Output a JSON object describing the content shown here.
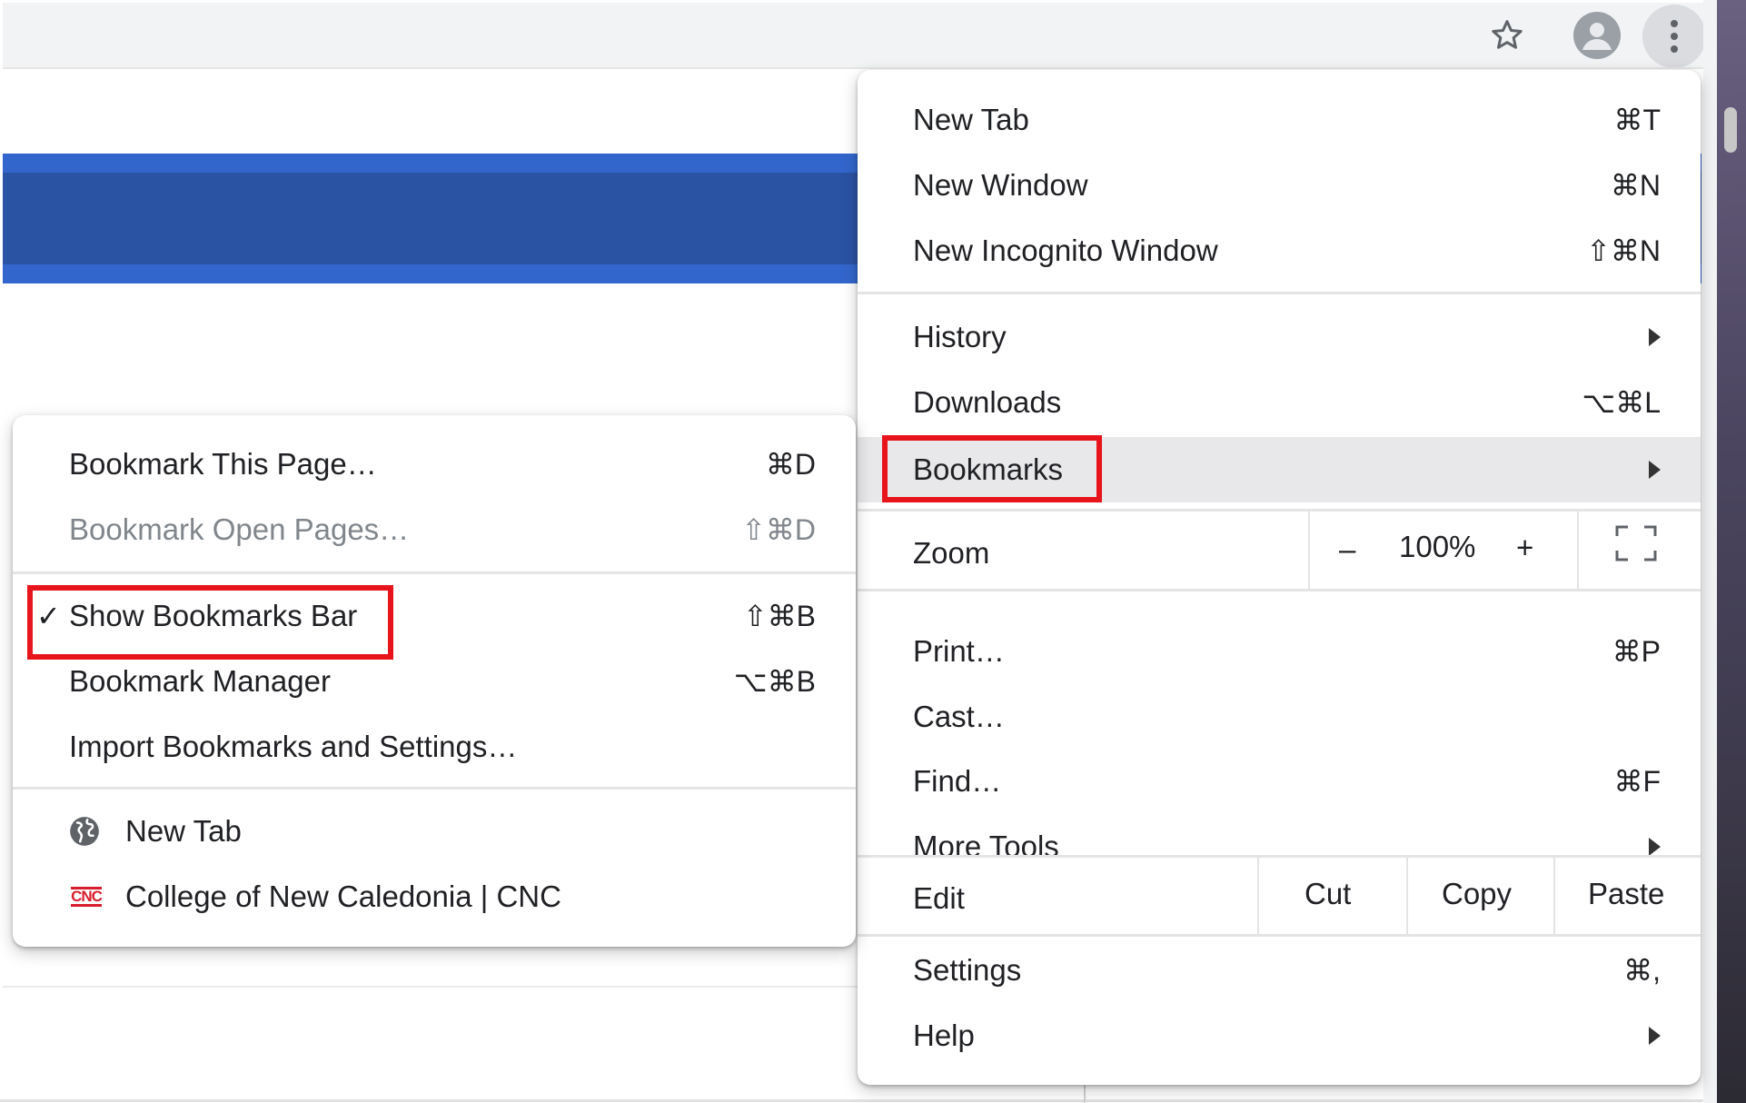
{
  "toolbar": {
    "icons": [
      "star-icon",
      "profile-icon",
      "more-vert-icon"
    ]
  },
  "main_menu": {
    "items": [
      {
        "label": "New Tab",
        "shortcut": "⌘T"
      },
      {
        "label": "New Window",
        "shortcut": "⌘N"
      },
      {
        "label": "New Incognito Window",
        "shortcut": "⇧⌘N"
      },
      {
        "label": "History",
        "shortcut": ""
      },
      {
        "label": "Downloads",
        "shortcut": "⌥⌘L"
      },
      {
        "label": "Bookmarks",
        "shortcut": ""
      },
      {
        "label": "Print…",
        "shortcut": "⌘P"
      },
      {
        "label": "Cast…",
        "shortcut": ""
      },
      {
        "label": "Find…",
        "shortcut": "⌘F"
      },
      {
        "label": "More Tools",
        "shortcut": ""
      },
      {
        "label": "Settings",
        "shortcut": "⌘,"
      },
      {
        "label": "Help",
        "shortcut": ""
      }
    ],
    "zoom": {
      "label": "Zoom",
      "minus": "–",
      "value": "100%",
      "plus": "+"
    },
    "edit": {
      "label": "Edit",
      "cut": "Cut",
      "copy": "Copy",
      "paste": "Paste"
    }
  },
  "bookmarks_menu": {
    "items": [
      {
        "label": "Bookmark This Page…",
        "shortcut": "⌘D"
      },
      {
        "label": "Bookmark Open Pages…",
        "shortcut": "⇧⌘D"
      },
      {
        "label": "Show Bookmarks Bar",
        "shortcut": "⇧⌘B",
        "checked": "✓"
      },
      {
        "label": "Bookmark Manager",
        "shortcut": "⌥⌘B"
      },
      {
        "label": "Import Bookmarks and Settings…",
        "shortcut": ""
      }
    ],
    "bookmarks": [
      {
        "label": "New Tab",
        "icon": "globe-icon"
      },
      {
        "label": "College of New Caledonia | CNC",
        "icon": "cnc-favicon",
        "favicon_text": "CNC"
      }
    ]
  },
  "colors": {
    "highlight_box": "#e8141b",
    "page_blue": "#2b53a4",
    "page_blue_light": "#3366cc",
    "cnc_red": "#d81e2c"
  }
}
